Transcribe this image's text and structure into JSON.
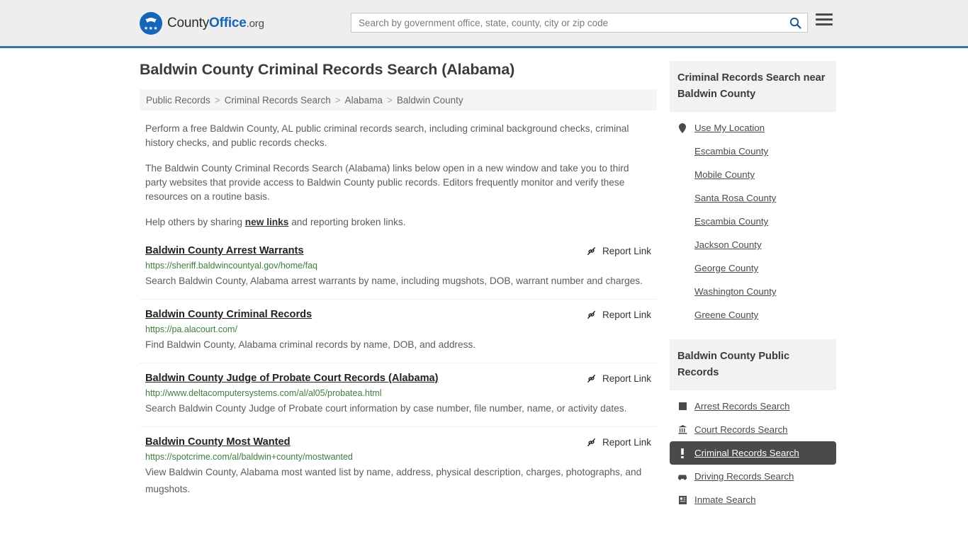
{
  "header": {
    "logo": {
      "text_county": "County",
      "text_office": "Office",
      "text_org": ".org",
      "badge_icon": "eagle-shield-icon",
      "stars": "★★★"
    },
    "search": {
      "placeholder": "Search by government office, state, county, city or zip code",
      "value": "",
      "search_icon": "search-icon"
    },
    "menu_icon": "hamburger-menu-icon",
    "accent_color": "#3b76a8"
  },
  "main": {
    "page_title": "Baldwin County Criminal Records Search (Alabama)",
    "breadcrumb": [
      "Public Records",
      "Criminal Records Search",
      "Alabama",
      "Baldwin County"
    ],
    "breadcrumb_separator": ">",
    "intro": {
      "p1": "Perform a free Baldwin County, AL public criminal records search, including criminal background checks, criminal history checks, and public records checks.",
      "p2": "The Baldwin County Criminal Records Search (Alabama) links below open in a new window and take you to third party websites that provide access to Baldwin County public records. Editors frequently monitor and verify these resources on a routine basis.",
      "p3_before": "Help others by sharing ",
      "p3_link": "new links",
      "p3_after": " and reporting broken links."
    },
    "report_link_label": "Report Link",
    "report_link_icon": "broken-link-icon",
    "results": [
      {
        "title": "Baldwin County Arrest Warrants",
        "url": "https://sheriff.baldwincountyal.gov/home/faq",
        "description": "Search Baldwin County, Alabama arrest warrants by name, including mugshots, DOB, warrant number and charges."
      },
      {
        "title": "Baldwin County Criminal Records",
        "url": "https://pa.alacourt.com/",
        "description": "Find Baldwin County, Alabama criminal records by name, DOB, and address."
      },
      {
        "title": "Baldwin County Judge of Probate Court Records (Alabama)",
        "url": "http://www.deltacomputersystems.com/al/al05/probatea.html",
        "description": "Search Baldwin County Judge of Probate court information by case number, file number, name, or activity dates."
      },
      {
        "title": "Baldwin County Most Wanted",
        "url": "https://spotcrime.com/al/baldwin+county/mostwanted",
        "description": "View Baldwin County, Alabama most wanted list by name, address, physical description, charges, photographs, and mugshots."
      }
    ]
  },
  "sidebar": {
    "nearby": {
      "title": "Criminal Records Search near Baldwin County",
      "items": [
        {
          "label": "Use My Location",
          "icon": "map-pin-icon",
          "active": false
        },
        {
          "label": "Escambia County",
          "icon": "",
          "active": false
        },
        {
          "label": "Mobile County",
          "icon": "",
          "active": false
        },
        {
          "label": "Santa Rosa County",
          "icon": "",
          "active": false
        },
        {
          "label": "Escambia County",
          "icon": "",
          "active": false
        },
        {
          "label": "Jackson County",
          "icon": "",
          "active": false
        },
        {
          "label": "George County",
          "icon": "",
          "active": false
        },
        {
          "label": "Washington County",
          "icon": "",
          "active": false
        },
        {
          "label": "Greene County",
          "icon": "",
          "active": false
        }
      ]
    },
    "public_records": {
      "title": "Baldwin County Public Records",
      "items": [
        {
          "label": "Arrest Records Search",
          "icon": "square-icon",
          "active": false
        },
        {
          "label": "Court Records Search",
          "icon": "courthouse-icon",
          "active": false
        },
        {
          "label": "Criminal Records Search",
          "icon": "exclamation-icon",
          "active": true
        },
        {
          "label": "Driving Records Search",
          "icon": "car-icon",
          "active": false
        },
        {
          "label": "Inmate Search",
          "icon": "id-card-icon",
          "active": false
        }
      ],
      "active_bg_color": "#4a4a4a"
    }
  }
}
